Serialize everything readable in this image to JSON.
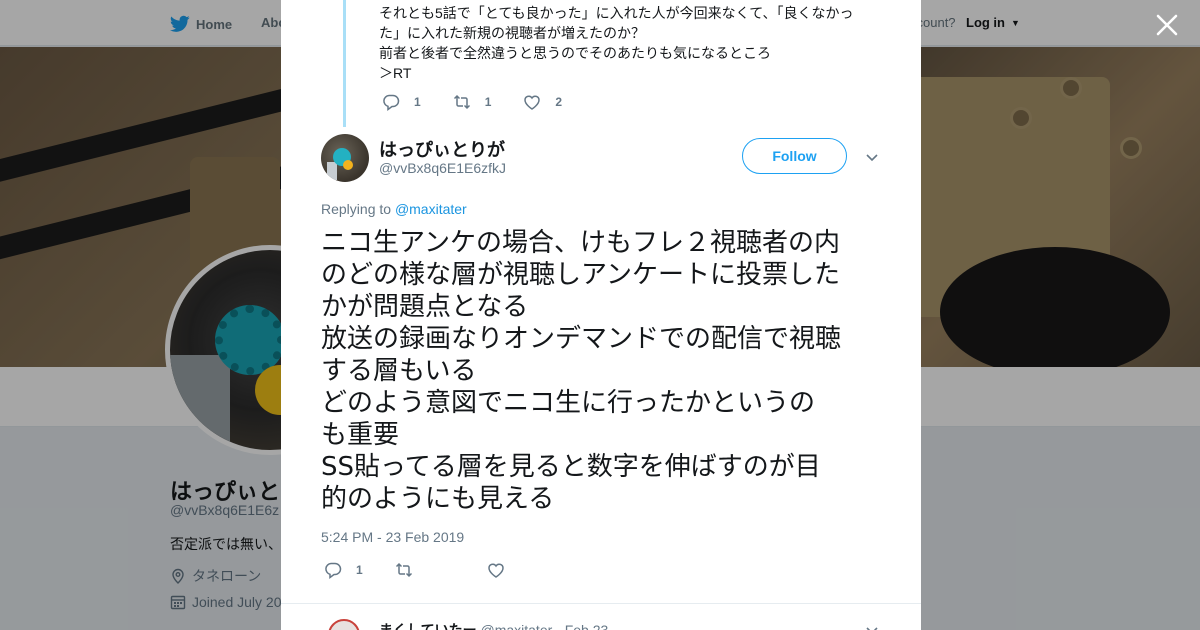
{
  "nav": {
    "home_label": "Home",
    "about_label": "Abo",
    "account_text": "ccount?",
    "login_label": "Log in"
  },
  "background_profile": {
    "display_name": "はっぴぃと",
    "handle": "@vvBx8q6E1E6z",
    "bio": "否定派では無い、",
    "location": "タネローン",
    "joined": "Joined July 20"
  },
  "previous_tweet": {
    "text": "それとも5話で「とても良かった」に入れた人が今回来なくて、「良くなかっ\nた」に入れた新規の視聴者が増えたのか？\n前者と後者で全然違うと思うのでそのあたりも気になるところ\n＞RT",
    "reply_count": "1",
    "retweet_count": "1",
    "like_count": "2"
  },
  "tweet": {
    "display_name": "はっぴぃとりが",
    "screen_name": "@vvBx8q6E1E6zfkJ",
    "follow_label": "Follow",
    "replying_prefix": "Replying to",
    "replying_to": "@maxitater",
    "text": "ニコ生アンケの場合、けもフレ２視聴者の内\nのどの様な層が視聴しアンケートに投票した\nかが問題点となる\n放送の録画なりオンデマンドでの配信で視聴\nする層もいる\nどのよう意図でニコ生に行ったかというの\nも重要\nSS貼ってる層を見ると数字を伸ばすのが目\n的のようにも見える",
    "timestamp": "5:24 PM - 23 Feb 2019",
    "reply_count": "1",
    "retweet_count": "",
    "like_count": ""
  },
  "next_tweet": {
    "display_name": "まくしていたー",
    "handle_date": "@maxitater · Feb 23"
  },
  "icons": [
    "bird-icon",
    "reply-icon",
    "retweet-icon",
    "heart-icon",
    "chevron-down-icon",
    "close-icon",
    "location-icon",
    "calendar-icon"
  ],
  "colors": {
    "brand_blue": "#1da1f2",
    "link_blue": "#1b95e0",
    "thread_line": "#a9dff7",
    "muted_text": "#657786"
  }
}
